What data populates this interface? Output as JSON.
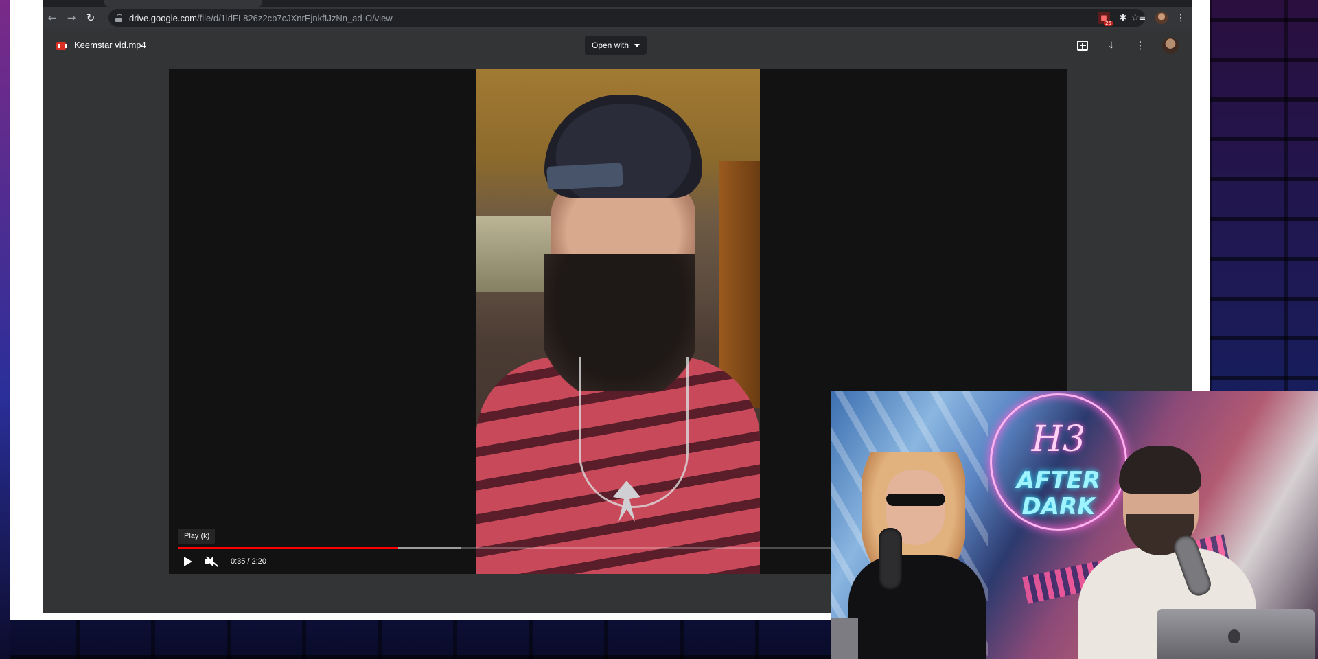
{
  "browser": {
    "nav": {
      "back_icon": "arrow-left-icon",
      "forward_icon": "arrow-right-icon",
      "reload_icon": "reload-icon"
    },
    "url": {
      "host": "drive.google.com",
      "path": "/file/d/1ldFL826z2cb7cJXnrEjnkfIJzNn_ad-O/view"
    },
    "extension_badge": "25"
  },
  "drive": {
    "file_name": "Keemstar vid.mp4",
    "open_with_label": "Open with",
    "actions": [
      "add-comment-icon",
      "download-icon",
      "more-vert-icon",
      "avatar"
    ]
  },
  "player": {
    "tooltip": "Play (k)",
    "time": "0:35 / 2:20",
    "progress": {
      "current_seconds": 35,
      "total_seconds": 140,
      "buffered_seconds": 45
    },
    "progress_color": "#ff0000"
  },
  "webcam": {
    "sign_logo": "H3",
    "sign_line1": "AFTER",
    "sign_line2": "DARK"
  }
}
